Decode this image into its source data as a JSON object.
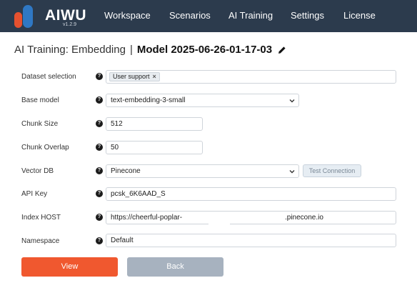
{
  "app": {
    "brand": "AIWU",
    "version": "v1.2.9"
  },
  "nav": {
    "items": [
      {
        "label": "Workspace"
      },
      {
        "label": "Scenarios"
      },
      {
        "label": "AI Training"
      },
      {
        "label": "Settings"
      },
      {
        "label": "License"
      }
    ]
  },
  "header": {
    "breadcrumb": "AI Training: Embedding",
    "separator": "|",
    "model_name": "Model 2025-06-26-01-17-03"
  },
  "form": {
    "help_glyph": "?",
    "dataset": {
      "label": "Dataset selection",
      "tags": [
        {
          "label": "User support",
          "remove": "×"
        }
      ]
    },
    "base_model": {
      "label": "Base model",
      "value": "text-embedding-3-small"
    },
    "chunk_size": {
      "label": "Chunk Size",
      "value": "512"
    },
    "chunk_overlap": {
      "label": "Chunk Overlap",
      "value": "50"
    },
    "vector_db": {
      "label": "Vector DB",
      "value": "Pinecone",
      "test_label": "Test Connection"
    },
    "api_key": {
      "label": "API Key",
      "value": "pcsk_6K6AAD_S"
    },
    "index_host": {
      "label": "Index HOST",
      "value_start": "https://cheerful-poplar-",
      "value_end": ".pinecone.io"
    },
    "namespace": {
      "label": "Namespace",
      "value": "Default"
    }
  },
  "actions": {
    "view_label": "View",
    "back_label": "Back"
  },
  "colors": {
    "topbar": "#2c3b4d",
    "accent": "#f0582f",
    "secondary": "#a7b2bf"
  }
}
